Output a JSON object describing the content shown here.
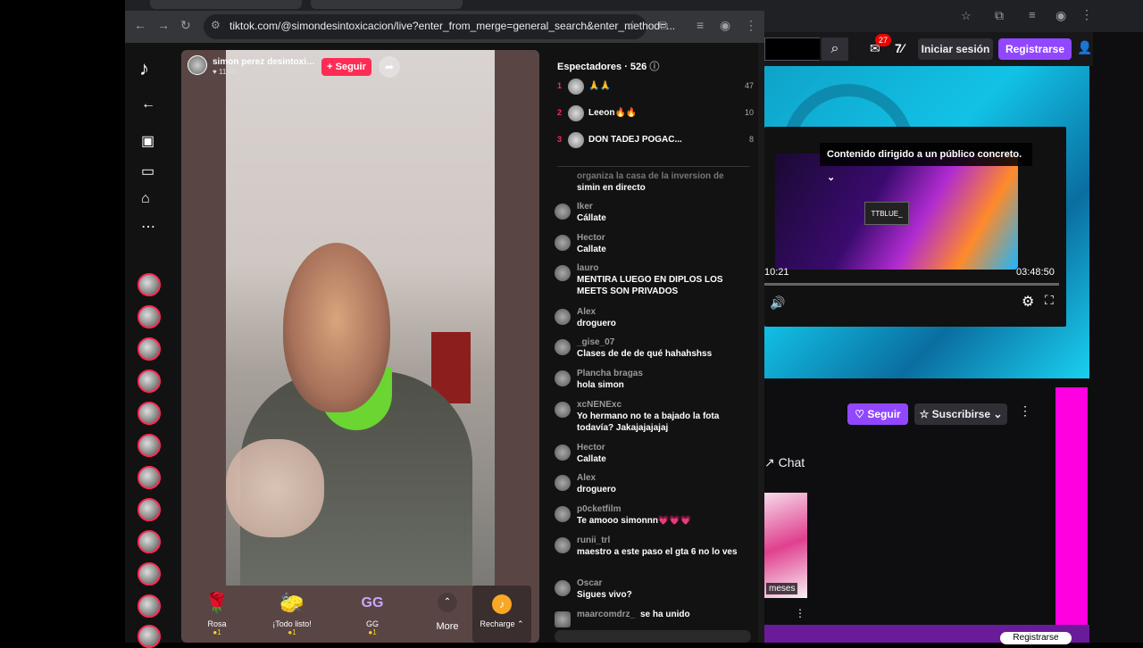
{
  "browser_front": {
    "url": "tiktok.com/@simondesintoxicacion/live?enter_from_merge=general_search&enter_method=..."
  },
  "browser_back": {
    "url_placeholder": ""
  },
  "tiktok": {
    "host": {
      "name": "simon perez desintoxica...",
      "likes": "11.4K",
      "follow_label": "+ Seguir"
    },
    "viewers": {
      "title": "Espectadores · 526",
      "top": [
        {
          "rank": "1",
          "name": "🙏🙏",
          "score": "47"
        },
        {
          "rank": "2",
          "name": "Leeon🔥🔥",
          "score": "10"
        },
        {
          "rank": "3",
          "name": "DON TADEJ POGAC...",
          "score": "8"
        }
      ]
    },
    "chat": [
      {
        "user": "organiza la casa de la inversion de",
        "text": "simin en directo"
      },
      {
        "user": "Iker",
        "text": "Cállate"
      },
      {
        "user": "Hector",
        "text": "Callate"
      },
      {
        "user": "lauro",
        "text": "MENTIRA LUEGO EN DIPLOS LOS MEETS SON PRIVADOS"
      },
      {
        "user": "Alex",
        "text": "droguero"
      },
      {
        "user": "_gise_07",
        "text": "Clases de de de qué hahahshss"
      },
      {
        "user": "Plancha bragas",
        "text": "hola simon"
      },
      {
        "user": "xcNENExc",
        "text": "Yo hermano no te a bajado la fota todavía? Jakajajajajaj"
      },
      {
        "user": "Hector",
        "text": "Callate"
      },
      {
        "user": "Alex",
        "text": "droguero"
      },
      {
        "user": "p0cketfilm",
        "text": "Te amooo simonnn💗💗💗"
      },
      {
        "user": "runii_trl",
        "text": "maestro a este paso el gta 6 no lo ves"
      },
      {
        "user": "Oscar",
        "text": "Sigues vivo?"
      },
      {
        "user": "maarcomdrz_",
        "text": "se ha unido"
      }
    ],
    "gifts": [
      {
        "icon": "🌹",
        "label": "Rosa",
        "cost": "●1"
      },
      {
        "icon": "🧽",
        "label": "¡Todo listo!",
        "cost": "●1"
      },
      {
        "icon": "GG",
        "label": "GG",
        "cost": "●1"
      }
    ],
    "more_label": "More",
    "recharge_label": "Recharge ⌃"
  },
  "twitch": {
    "notif_count": "27",
    "login_label": "Iniciar sesión",
    "register_label": "Registrarse",
    "advisory": "Contenido dirigido a un público concreto.",
    "screen_text": "TTBLUE_",
    "time_left": "10:21",
    "time_right": "03:48:50",
    "follow_label": "♡ Seguir",
    "subscribe_label": "☆ Suscribirse ⌄",
    "chat_label": "↗ Chat",
    "thumb_label": "meses",
    "bottom_register": "Registrarse"
  },
  "colors": {
    "tiktok_red": "#fe2c55",
    "twitch_purple": "#9147ff",
    "pink": "#ff00e0"
  }
}
